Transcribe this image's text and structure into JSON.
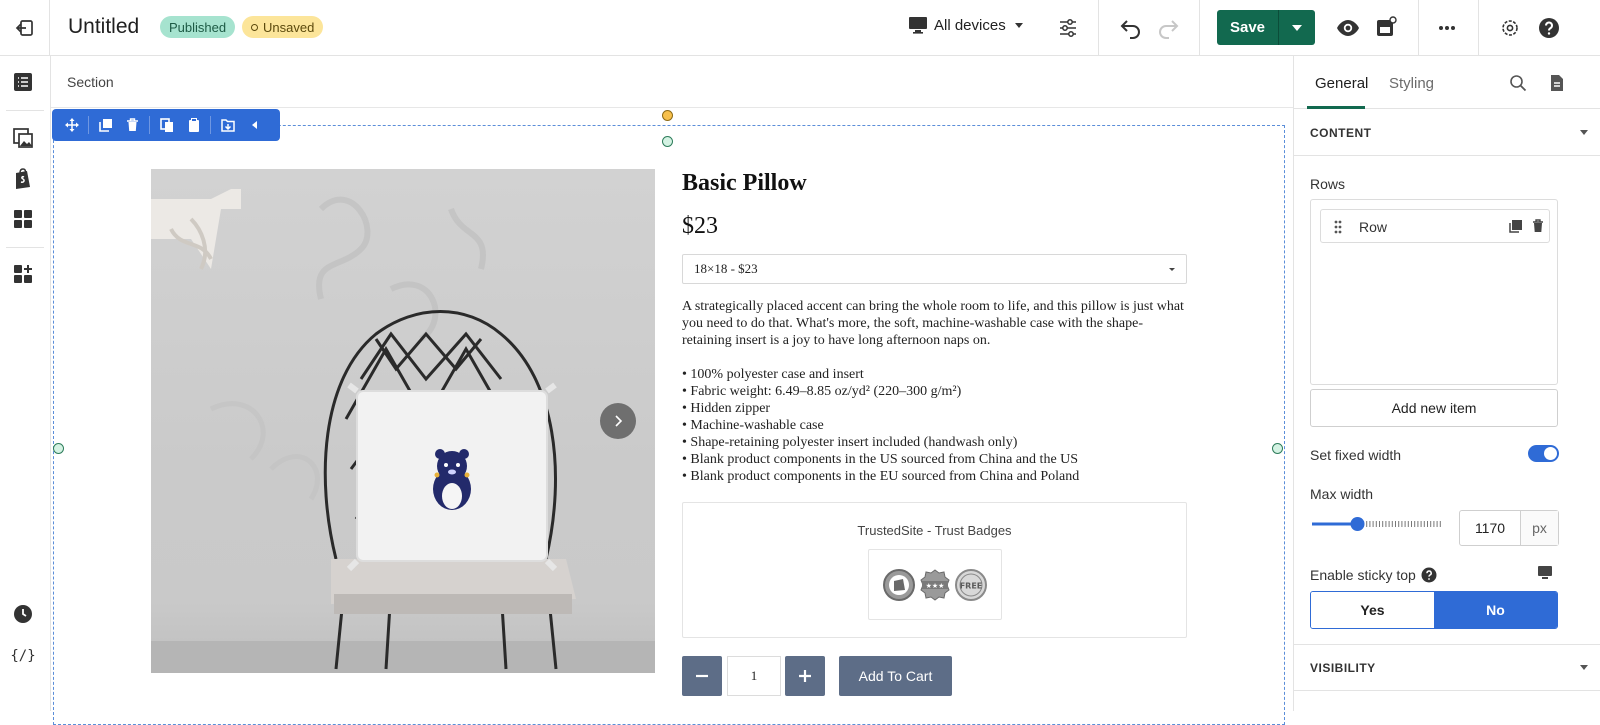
{
  "app": {
    "title": "Untitled",
    "status_published": "Published",
    "status_unsaved": "Unsaved",
    "device_label": "All devices",
    "save_label": "Save"
  },
  "canvas": {
    "breadcrumb": "Section"
  },
  "product": {
    "title": "Basic Pillow",
    "price": "$23",
    "variant_selected": "18×18 - $23",
    "description": "A strategically placed accent can bring the whole room to life, and this pillow is just what you need to do that. What's more, the soft, machine-washable case with the shape-retaining insert is a joy to have long afternoon naps on.",
    "features": [
      "• 100% polyester case and insert",
      "• Fabric weight: 6.49–8.85 oz/yd² (220–300 g/m²)",
      "• Hidden zipper",
      "• Machine-washable case",
      "• Shape-retaining polyester insert included (handwash only)",
      "• Blank product components in the US sourced from China and the US",
      "• Blank product components in the EU sourced from China and Poland"
    ],
    "trust_title": "TrustedSite - Trust Badges",
    "quantity": "1",
    "add_to_cart": "Add To Cart",
    "badge_free": "FREE",
    "badge_stars": "★★★"
  },
  "panel": {
    "tab_general": "General",
    "tab_styling": "Styling",
    "content_header": "CONTENT",
    "rows_label": "Rows",
    "row_item": "Row",
    "add_item": "Add new item",
    "fixed_width_label": "Set fixed width",
    "fixed_width_on": true,
    "max_width_label": "Max width",
    "max_width_value": "1170",
    "max_width_unit": "px",
    "max_width_slider_fraction": 0.35,
    "sticky_label": "Enable sticky top",
    "sticky_yes": "Yes",
    "sticky_no": "No",
    "sticky_selected": "No",
    "visibility_header": "VISIBILITY"
  },
  "colors": {
    "save_green": "#12694f",
    "accent_blue": "#2f6bd6",
    "published_bg": "#a6e3cf",
    "unsaved_bg": "#fce59a",
    "cart_slate": "#5d6d87"
  }
}
